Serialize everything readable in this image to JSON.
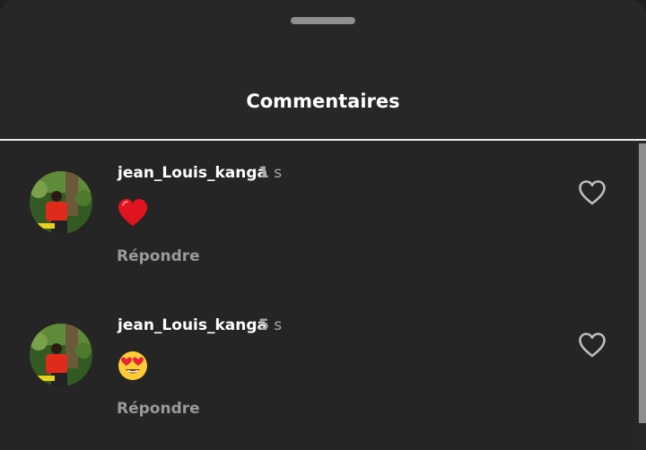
{
  "sheet": {
    "title": "Commentaires"
  },
  "comments": [
    {
      "username": "jean_Louis_kanga",
      "time_value": "1",
      "time_unit": "s",
      "emoji": "red-heart",
      "reply_label": "Répondre",
      "like_icon": "heart-outline-icon"
    },
    {
      "username": "jean_Louis_kanga",
      "time_value": "5",
      "time_unit": "s",
      "emoji": "heart-eyes-face",
      "reply_label": "Répondre",
      "like_icon": "heart-outline-icon"
    }
  ],
  "colors": {
    "background": "#272727",
    "text": "#ffffff",
    "muted": "#9a9a9a",
    "heart": "#e0141f"
  }
}
